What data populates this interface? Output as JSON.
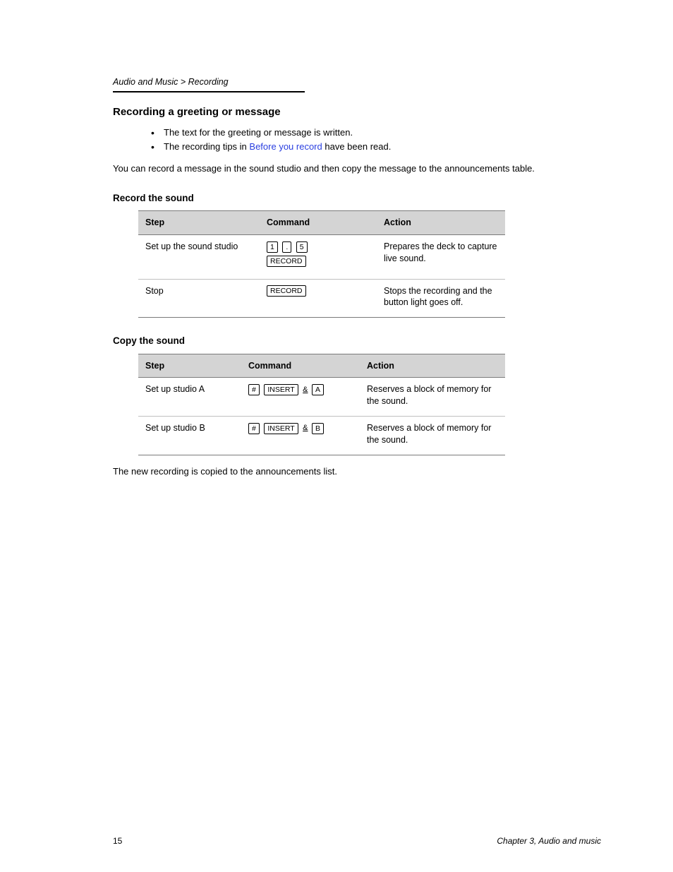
{
  "breadcrumb": "Audio and Music > Recording",
  "section_title": "Recording a greeting or message",
  "bullets": [
    {
      "text_a": "The text for the greeting or message is written."
    },
    {
      "text_a": "The recording tips in ",
      "link": "Before you record",
      "text_b": " have been read."
    }
  ],
  "intro": "You can record a message in the sound studio and then copy the message to the announcements table.",
  "table1": {
    "caption": "Record the sound",
    "headers": [
      "Step",
      "Command",
      "Action"
    ],
    "rows": [
      {
        "step": "Set up the sound studio",
        "commands": [
          [
            {
              "type": "key",
              "value": "1"
            },
            {
              "type": "key",
              "value": "."
            },
            {
              "type": "key",
              "value": "5"
            }
          ],
          [
            {
              "type": "key",
              "value": "RECORD"
            }
          ]
        ],
        "action": "Prepares the deck to capture live sound."
      },
      {
        "step": "Stop",
        "commands": [
          [
            {
              "type": "key",
              "value": "RECORD"
            }
          ]
        ],
        "action": "Stops the recording and the button light goes off."
      }
    ]
  },
  "table2": {
    "caption": "Copy the sound",
    "headers": [
      "Step",
      "Command",
      "Action"
    ],
    "rows": [
      {
        "step": "Set up studio A",
        "commands": [
          [
            {
              "type": "key",
              "value": "#"
            },
            {
              "type": "key",
              "value": "INSERT"
            },
            {
              "type": "glyph_underline",
              "value": "&"
            },
            {
              "type": "key",
              "value": "A"
            }
          ]
        ],
        "action": "Reserves a block of memory for the sound."
      },
      {
        "step": "Set up studio B",
        "commands": [
          [
            {
              "type": "key",
              "value": "#"
            },
            {
              "type": "key",
              "value": "INSERT"
            },
            {
              "type": "glyph_underline",
              "value": "&"
            },
            {
              "type": "key",
              "value": "B"
            }
          ]
        ],
        "action": "Reserves a block of memory for the sound."
      }
    ]
  },
  "outro": "The new recording is copied to the announcements list.",
  "footer_left": "15",
  "footer_right": "Chapter 3, Audio and music"
}
